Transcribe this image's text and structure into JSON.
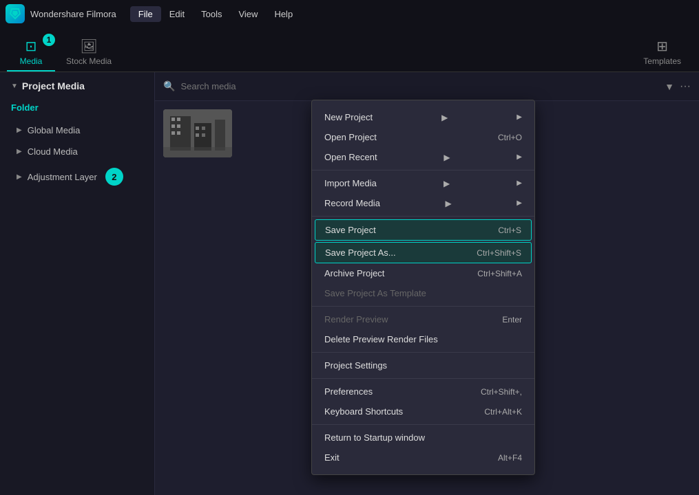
{
  "app": {
    "logo": "F",
    "title": "Wondershare Filmora",
    "menu_items": [
      "File",
      "Edit",
      "Tools",
      "View",
      "Help"
    ]
  },
  "tabs": [
    {
      "id": "media",
      "label": "Media",
      "icon": "▣",
      "active": true
    },
    {
      "id": "stock-media",
      "label": "Stock Media",
      "icon": "🖼"
    },
    {
      "id": "templates",
      "label": "Templates",
      "icon": "⊞"
    }
  ],
  "badge1": "1",
  "badge2": "2",
  "sidebar": {
    "header": "Project Media",
    "folder_label": "Folder",
    "items": [
      {
        "label": "Global Media"
      },
      {
        "label": "Cloud Media"
      },
      {
        "label": "Adjustment Layer"
      }
    ]
  },
  "search": {
    "placeholder": "Search media"
  },
  "file_menu": {
    "active_item": "File",
    "sections": [
      {
        "items": [
          {
            "label": "New Project",
            "shortcut": "",
            "has_arrow": true,
            "disabled": false,
            "highlighted": false
          },
          {
            "label": "Open Project",
            "shortcut": "Ctrl+O",
            "has_arrow": false,
            "disabled": false,
            "highlighted": false
          },
          {
            "label": "Open Recent",
            "shortcut": "",
            "has_arrow": true,
            "disabled": false,
            "highlighted": false
          }
        ]
      },
      {
        "items": [
          {
            "label": "Import Media",
            "shortcut": "",
            "has_arrow": true,
            "disabled": false,
            "highlighted": false
          },
          {
            "label": "Record Media",
            "shortcut": "",
            "has_arrow": true,
            "disabled": false,
            "highlighted": false
          }
        ]
      },
      {
        "items": [
          {
            "label": "Save Project",
            "shortcut": "Ctrl+S",
            "has_arrow": false,
            "disabled": false,
            "highlighted": true
          },
          {
            "label": "Save Project As...",
            "shortcut": "Ctrl+Shift+S",
            "has_arrow": false,
            "disabled": false,
            "highlighted": true
          },
          {
            "label": "Archive Project",
            "shortcut": "Ctrl+Shift+A",
            "has_arrow": false,
            "disabled": false,
            "highlighted": false
          },
          {
            "label": "Save Project As Template",
            "shortcut": "",
            "has_arrow": false,
            "disabled": true,
            "highlighted": false
          }
        ]
      },
      {
        "items": [
          {
            "label": "Render Preview",
            "shortcut": "Enter",
            "has_arrow": false,
            "disabled": true,
            "highlighted": false
          },
          {
            "label": "Delete Preview Render Files",
            "shortcut": "",
            "has_arrow": false,
            "disabled": false,
            "highlighted": false
          }
        ]
      },
      {
        "items": [
          {
            "label": "Project Settings",
            "shortcut": "",
            "has_arrow": false,
            "disabled": false,
            "highlighted": false
          }
        ]
      },
      {
        "items": [
          {
            "label": "Preferences",
            "shortcut": "Ctrl+Shift+,",
            "has_arrow": false,
            "disabled": false,
            "highlighted": false
          },
          {
            "label": "Keyboard Shortcuts",
            "shortcut": "Ctrl+Alt+K",
            "has_arrow": false,
            "disabled": false,
            "highlighted": false
          }
        ]
      },
      {
        "items": [
          {
            "label": "Return to Startup window",
            "shortcut": "",
            "has_arrow": false,
            "disabled": false,
            "highlighted": false
          },
          {
            "label": "Exit",
            "shortcut": "Alt+F4",
            "has_arrow": false,
            "disabled": false,
            "highlighted": false
          }
        ]
      }
    ]
  }
}
